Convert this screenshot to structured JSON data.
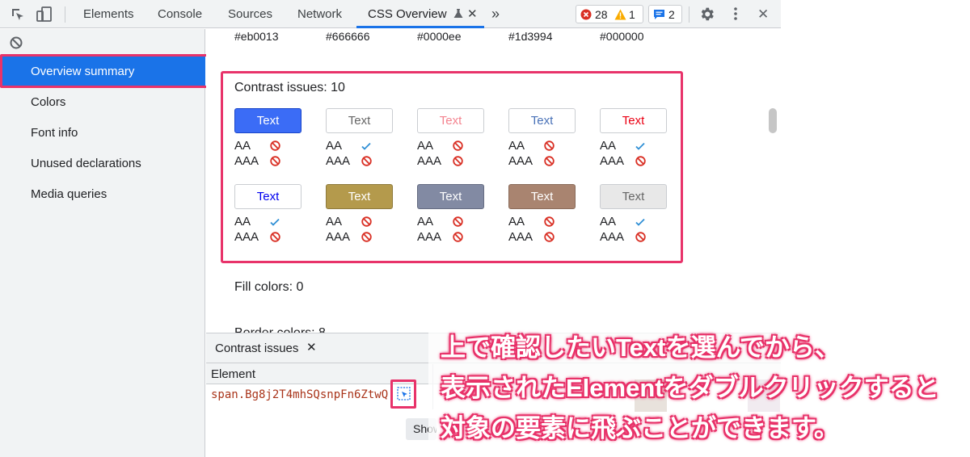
{
  "toolbar": {
    "tabs": [
      "Elements",
      "Console",
      "Sources",
      "Network",
      "CSS Overview"
    ],
    "more_chevron": "»",
    "close_tab": "✕",
    "close_devtools": "✕",
    "errors": "28",
    "warnings": "1",
    "messages": "2"
  },
  "sidebar": {
    "items": [
      "Overview summary",
      "Colors",
      "Font info",
      "Unused declarations",
      "Media queries"
    ]
  },
  "main": {
    "hex_values": [
      "#eb0013",
      "#666666",
      "#0000ee",
      "#1d3994",
      "#000000"
    ],
    "contrast_title": "Contrast issues: 10",
    "fill_title": "Fill colors: 0",
    "border_title": "Border colors: 8",
    "swatches": [
      {
        "label": "Text",
        "bg": "#3b6cf6",
        "fg": "#ffffff",
        "border": "#1a45c9",
        "aa": false,
        "aaa": false
      },
      {
        "label": "Text",
        "bg": "#ffffff",
        "fg": "#666666",
        "border": "#cacdd1",
        "aa": true,
        "aaa": false
      },
      {
        "label": "Text",
        "bg": "#ffffff",
        "fg": "#f4838f",
        "border": "#cacdd1",
        "aa": false,
        "aaa": false
      },
      {
        "label": "Text",
        "bg": "#ffffff",
        "fg": "#4a72b8",
        "border": "#cacdd1",
        "aa": false,
        "aaa": false
      },
      {
        "label": "Text",
        "bg": "#ffffff",
        "fg": "#eb0013",
        "border": "#cacdd1",
        "aa": true,
        "aaa": false
      },
      {
        "label": "Text",
        "bg": "#ffffff",
        "fg": "#0000ee",
        "border": "#cacdd1",
        "aa": true,
        "aaa": false
      },
      {
        "label": "Text",
        "bg": "#b49a4c",
        "fg": "#ffffff",
        "border": "#8e7a3c",
        "aa": false,
        "aaa": false
      },
      {
        "label": "Text",
        "bg": "#828aa3",
        "fg": "#ffffff",
        "border": "#656c82",
        "aa": false,
        "aaa": false
      },
      {
        "label": "Text",
        "bg": "#a98470",
        "fg": "#ffffff",
        "border": "#8a6b5a",
        "aa": false,
        "aaa": false
      },
      {
        "label": "Text",
        "bg": "#e8e8e8",
        "fg": "#666666",
        "border": "#cacdd1",
        "aa": true,
        "aaa": false
      }
    ],
    "aa_label": "AA",
    "aaa_label": "AAA"
  },
  "drawer": {
    "tab_label": "Contrast issues",
    "tab_close": "✕",
    "column_header": "Element",
    "row_selector": "span.Bg8j2T4mhSQsnpFn6ZtwQ",
    "tooltip": "Show"
  },
  "annotation": {
    "line1": "上で確認したいTextを選んでから、",
    "line2": "表示されたElementをダブルクリックすると",
    "line3": "対象の要素に飛ぶことができます。"
  },
  "colors": {
    "accent": "#1a73e8",
    "highlight": "#e8336a",
    "error": "#d93025",
    "warning": "#f9ab00",
    "pass": "#2f8fd5"
  }
}
